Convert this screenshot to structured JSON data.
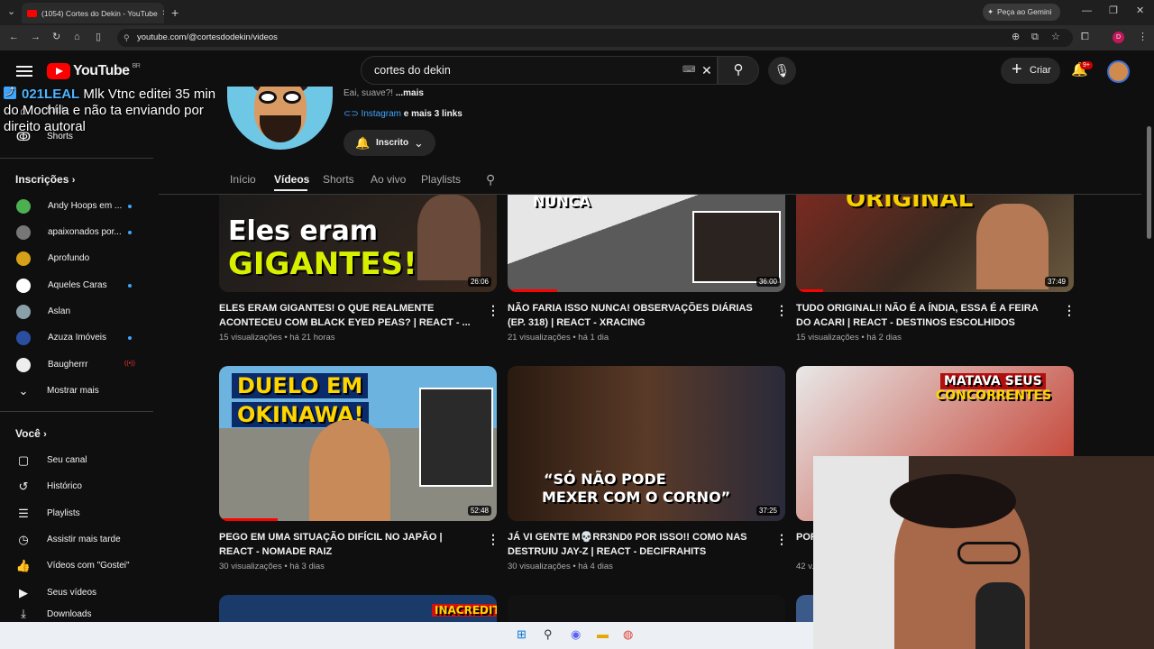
{
  "browser": {
    "tab_title": "(1054) Cortes do Dekin - YouTube",
    "url": "youtube.com/@cortesdodekin/videos",
    "gemini_label": "Peça ao Gemini",
    "profile_initial": "D"
  },
  "header": {
    "logo_text": "YouTube",
    "logo_region": "BR",
    "search_value": "cortes do dekin",
    "create_label": "Criar",
    "notif_badge": "9+"
  },
  "overlay": {
    "user": "021LEAL",
    "message": "Mlk Vtnc editei 35 min do Mochila e não ta enviando por direito autoral"
  },
  "sidebar": {
    "top_items": [
      {
        "label": "Início"
      },
      {
        "label": "Shorts"
      }
    ],
    "subs_title": "Inscrições",
    "subs": [
      {
        "label": "Andy Hoops em ...",
        "color": "#4caf50",
        "dot": true
      },
      {
        "label": "apaixonados por...",
        "color": "#777777",
        "dot": true
      },
      {
        "label": "Aprofundo",
        "color": "#d6a017",
        "dot": false
      },
      {
        "label": "Aqueles Caras",
        "color": "#ffffff",
        "dot": true
      },
      {
        "label": "Aslan",
        "color": "#8aa0a8",
        "dot": false
      },
      {
        "label": "Azuza Imóveis",
        "color": "#2a4fa0",
        "dot": true
      },
      {
        "label": "Baugherrr",
        "color": "#eeeeee",
        "dot": false,
        "live": "((•))"
      }
    ],
    "show_more": "Mostrar mais",
    "you_title": "Você",
    "you_items": [
      {
        "label": "Seu canal",
        "icon": "▢"
      },
      {
        "label": "Histórico",
        "icon": "↺"
      },
      {
        "label": "Playlists",
        "icon": "☰"
      },
      {
        "label": "Assistir mais tarde",
        "icon": "◷"
      },
      {
        "label": "Vídeos com \"Gostei\"",
        "icon": "👍"
      },
      {
        "label": "Seus vídeos",
        "icon": "▶"
      },
      {
        "label": "Downloads",
        "icon": "⤓"
      }
    ]
  },
  "channel": {
    "description": "Eai, suave?! ",
    "more": "...mais",
    "link_label": "Instagram",
    "more_links": " e mais 3 links",
    "subscribed_label": "Inscrito"
  },
  "tabs": [
    "Início",
    "Vídeos",
    "Shorts",
    "Ao vivo",
    "Playlists"
  ],
  "videos": [
    {
      "title": "ELES ERAM GIGANTES! O QUE REALMENTE ACONTECEU COM BLACK EYED PEAS? | REACT - ...",
      "meta": "15 visualizações • há 21 horas",
      "duration": "26:06",
      "thumb_top": "Eles eram",
      "thumb_big": "GIGANTES!!"
    },
    {
      "title": "NÃO FARIA ISSO NUNCA! OBSERVAÇÕES DIÁRIAS (EP. 318) | REACT - XRACING",
      "meta": "21 visualizações • há 1 dia",
      "duration": "36:00",
      "thumb_big": "NUNCA"
    },
    {
      "title": "TUDO ORIGINAL!! NÃO É A ÍNDIA, ESSA É A FEIRA DO ACARI | REACT - DESTINOS ESCOLHIDOS",
      "meta": "15 visualizações • há 2 dias",
      "duration": "37:49",
      "thumb_big": "ORIGINAL"
    },
    {
      "title": "PEGO EM UMA SITUAÇÃO DIFÍCIL NO JAPÃO | REACT - NOMADE RAIZ",
      "meta": "30 visualizações • há 3 dias",
      "duration": "52:48",
      "thumb_top": "DUELO EM",
      "thumb_big": "OKINAWA!"
    },
    {
      "title": "JÁ VI GENTE M💀RR3ND0 POR ISSO!! COMO NAS DESTRUIU JAY-Z | REACT - DECIFRAHITS",
      "meta": "30 visualizações • há 4 dias",
      "duration": "37:25",
      "thumb_top": "“SÓ NÃO PODE",
      "thumb_big": "MEXER COM O CORNO”"
    },
    {
      "title": "POR...",
      "meta": "42 v...",
      "duration": "",
      "thumb_top": "MATAVA SEUS",
      "thumb_big": "CONCORRENTES"
    }
  ],
  "row3_text": "INACREDITÁVEL"
}
